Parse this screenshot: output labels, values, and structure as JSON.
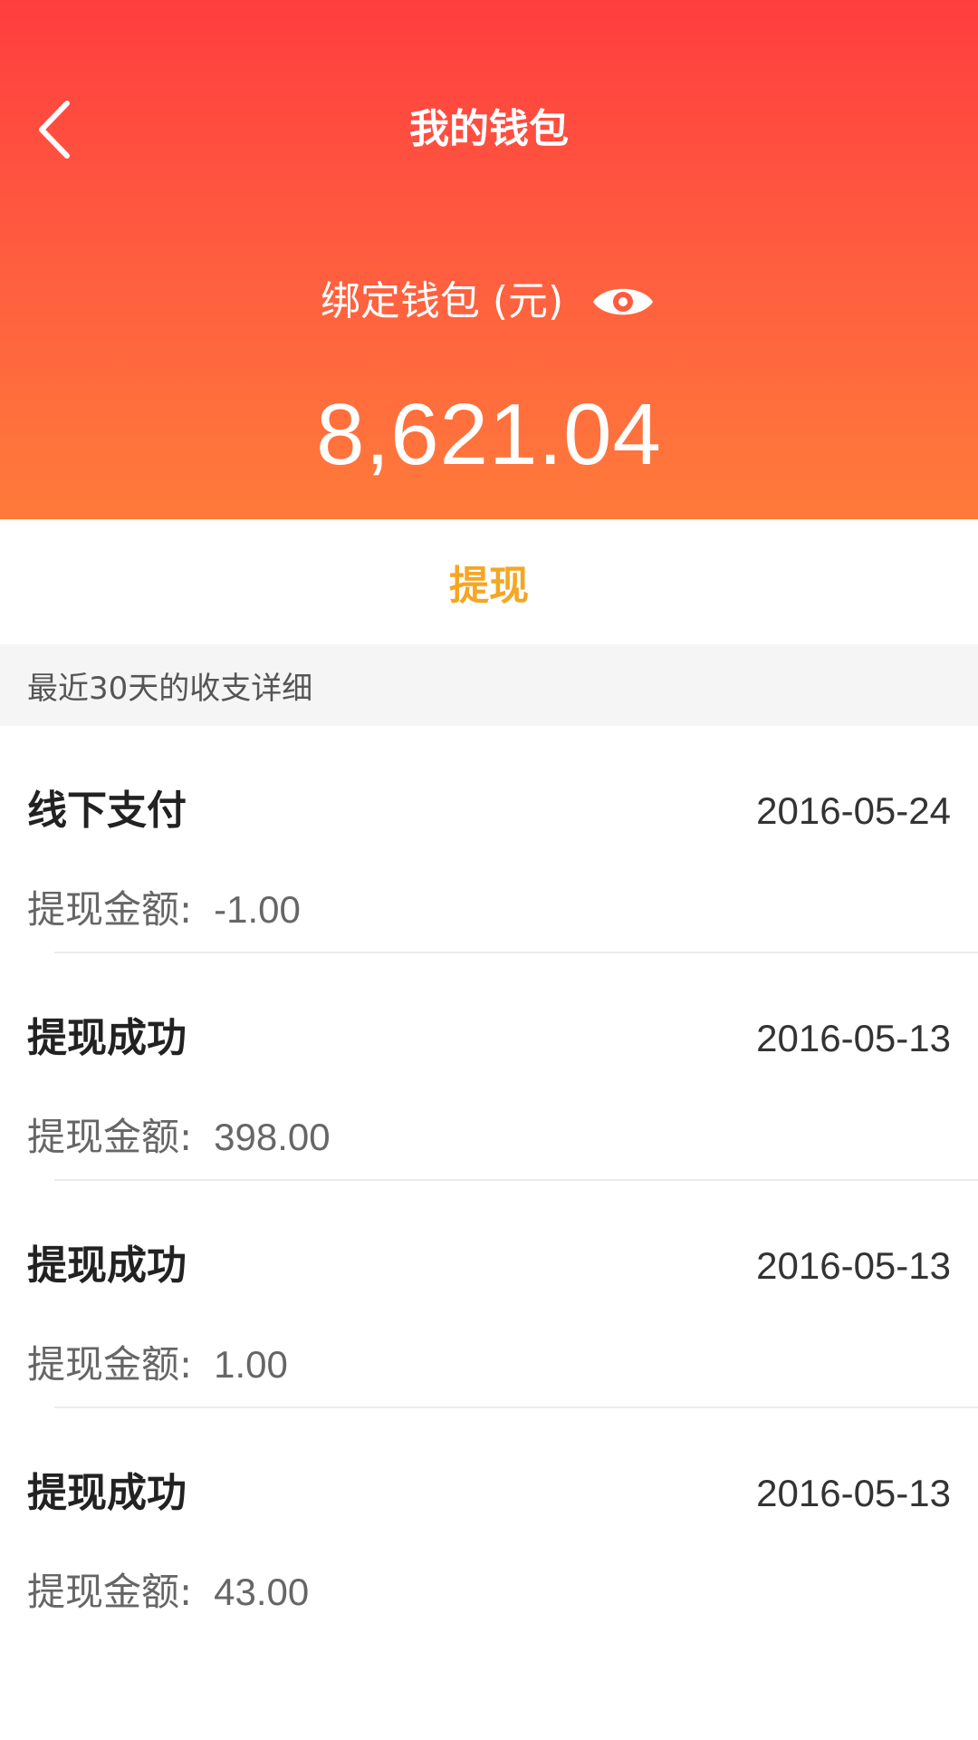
{
  "header": {
    "title": "我的钱包",
    "back_icon": "chevron-left-icon",
    "wallet_label": "绑定钱包 (元)",
    "eye_icon": "eye-icon",
    "balance": "8,621.04",
    "gradient_top": "#ff3d3e",
    "gradient_bottom": "#ff7b3a"
  },
  "withdraw": {
    "label": "提现",
    "color": "#f5a623"
  },
  "section": {
    "title": "最近30天的收支详细"
  },
  "transactions": [
    {
      "title": "线下支付",
      "date": "2016-05-24",
      "amount_label": "提现金额:",
      "amount": "-1.00"
    },
    {
      "title": "提现成功",
      "date": "2016-05-13",
      "amount_label": "提现金额:",
      "amount": "398.00"
    },
    {
      "title": "提现成功",
      "date": "2016-05-13",
      "amount_label": "提现金额:",
      "amount": "1.00"
    },
    {
      "title": "提现成功",
      "date": "2016-05-13",
      "amount_label": "提现金额:",
      "amount": "43.00"
    }
  ]
}
